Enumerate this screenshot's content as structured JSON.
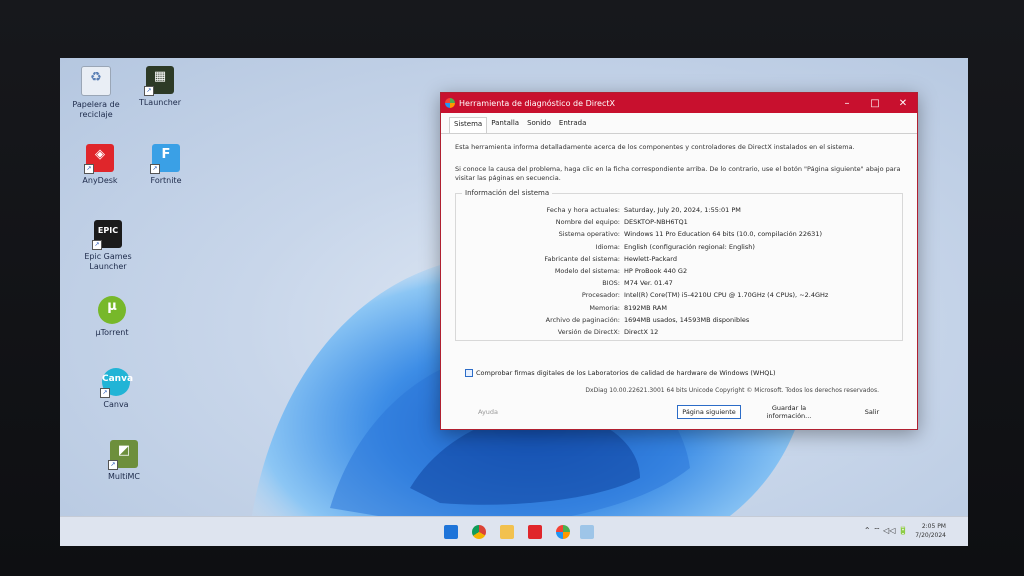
{
  "desktop_icons": [
    {
      "label": "Papelera de\nreciclaje",
      "icon": "recycle-bin-icon"
    },
    {
      "label": "TLauncher",
      "icon": "tlauncher-icon"
    },
    {
      "label": "AnyDesk",
      "icon": "anydesk-icon"
    },
    {
      "label": "Fortnite",
      "icon": "fortnite-icon"
    },
    {
      "label": "Epic Games\nLauncher",
      "icon": "epic-games-icon"
    },
    {
      "label": "µTorrent",
      "icon": "utorrent-icon"
    },
    {
      "label": "Canva",
      "icon": "canva-icon"
    },
    {
      "label": "MultiMC",
      "icon": "multimc-icon"
    }
  ],
  "dialog": {
    "title": "Herramienta de diagnóstico de DirectX",
    "controls": {
      "minimize": "–",
      "maximize": "□",
      "close": "✕"
    },
    "tabs": [
      "Sistema",
      "Pantalla",
      "Sonido",
      "Entrada"
    ],
    "intro": "Esta herramienta informa detalladamente acerca de los componentes y controladores de DirectX instalados en el sistema.",
    "hint": "Si conoce la causa del problema, haga clic en la ficha correspondiente arriba. De lo contrario, use el botón \"Página siguiente\" abajo para visitar las páginas en secuencia.",
    "group_title": "Información del sistema",
    "fields": [
      {
        "key": "Fecha y hora actuales:",
        "value": "Saturday, July 20, 2024, 1:55:01 PM"
      },
      {
        "key": "Nombre del equipo:",
        "value": "DESKTOP-NBH6TQ1"
      },
      {
        "key": "Sistema operativo:",
        "value": "Windows 11 Pro Education 64 bits (10.0, compilación 22631)"
      },
      {
        "key": "Idioma:",
        "value": "English (configuración regional: English)"
      },
      {
        "key": "Fabricante del sistema:",
        "value": "Hewlett-Packard"
      },
      {
        "key": "Modelo del sistema:",
        "value": "HP ProBook 440 G2"
      },
      {
        "key": "BIOS:",
        "value": "M74 Ver. 01.47"
      },
      {
        "key": "Procesador:",
        "value": "Intel(R) Core(TM) i5-4210U CPU @ 1.70GHz (4 CPUs), ~2.4GHz"
      },
      {
        "key": "Memoria:",
        "value": "8192MB RAM"
      },
      {
        "key": "Archivo de paginación:",
        "value": "1694MB usados, 14593MB disponibles"
      },
      {
        "key": "Versión de DirectX:",
        "value": "DirectX 12"
      }
    ],
    "checkbox_label": "Comprobar firmas digitales de los Laboratorios de calidad de hardware de Windows (WHQL)",
    "footer": "DxDiag 10.00.22621.3001 64 bits Unicode  Copyright © Microsoft. Todos los derechos reservados.",
    "buttons": {
      "help": "Ayuda",
      "next": "Página siguiente",
      "save": "Guardar la información...",
      "exit": "Salir"
    }
  },
  "taskbar": {
    "apps": [
      "windows-start-icon",
      "chrome-icon",
      "file-explorer-icon",
      "anydesk-taskbar-icon",
      "dxdiag-taskbar-icon",
      "photos-icon"
    ],
    "tray": "⌃  ⌔ ◁◁ 🔋",
    "time": "2:05 PM",
    "date": "7/20/2024"
  },
  "colors": {
    "title_bar": "#c8102e",
    "accent": "#2c6cc7"
  }
}
